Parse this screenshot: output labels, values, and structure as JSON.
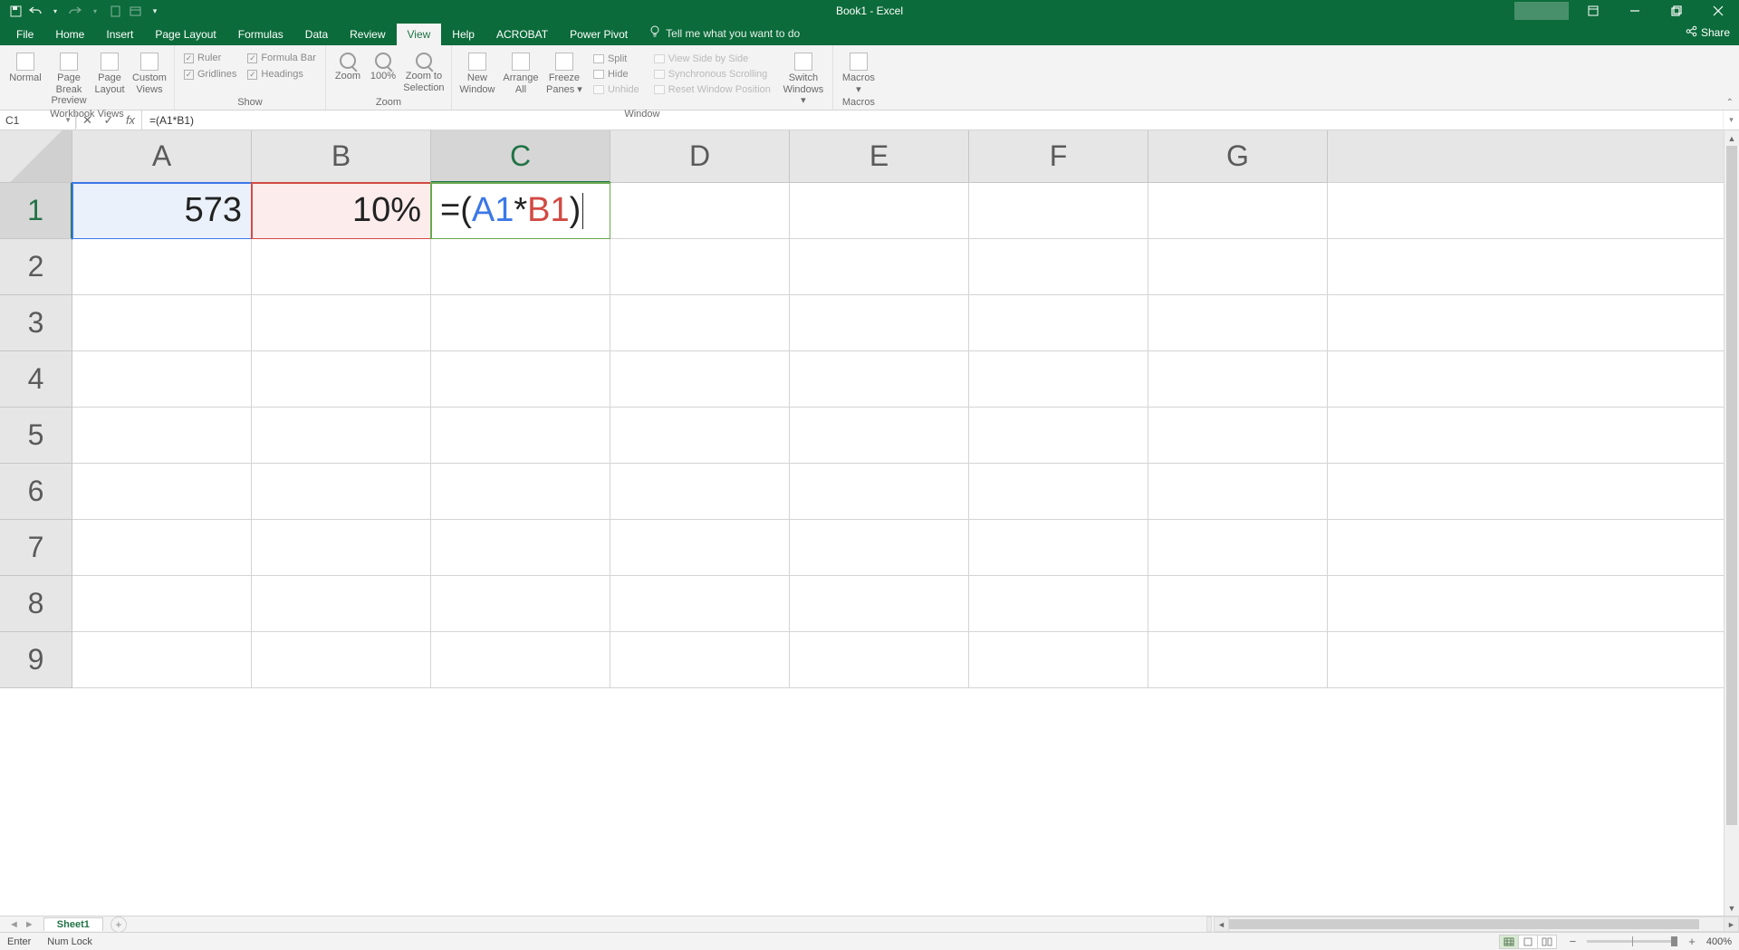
{
  "app": {
    "title": "Book1 - Excel"
  },
  "qat": {
    "items": [
      "save-icon",
      "undo-icon",
      "redo-icon",
      "new-icon",
      "grid-icon",
      "customize-icon"
    ]
  },
  "window": {
    "ribbon_display": "▾"
  },
  "tabs": {
    "file": "File",
    "list": [
      "Home",
      "Insert",
      "Page Layout",
      "Formulas",
      "Data",
      "Review",
      "View",
      "Help",
      "ACROBAT",
      "Power Pivot"
    ],
    "active_index": 6,
    "tell_me": "Tell me what you want to do",
    "share": "Share"
  },
  "ribbon": {
    "groups": {
      "workbook_views": {
        "label": "Workbook Views",
        "normal": "Normal",
        "page_break": "Page Break\nPreview",
        "page_layout": "Page\nLayout",
        "custom_views": "Custom\nViews"
      },
      "show": {
        "label": "Show",
        "ruler": "Ruler",
        "formula_bar": "Formula Bar",
        "gridlines": "Gridlines",
        "headings": "Headings"
      },
      "zoom": {
        "label": "Zoom",
        "zoom": "Zoom",
        "hundred": "100%",
        "to_selection": "Zoom to\nSelection"
      },
      "window": {
        "label": "Window",
        "new_window": "New\nWindow",
        "arrange_all": "Arrange\nAll",
        "freeze_panes": "Freeze\nPanes ▾",
        "split": "Split",
        "hide": "Hide",
        "unhide": "Unhide",
        "side_by_side": "View Side by Side",
        "sync_scroll": "Synchronous Scrolling",
        "reset_pos": "Reset Window Position",
        "switch": "Switch\nWindows ▾"
      },
      "macros": {
        "label": "Macros",
        "macros": "Macros\n▾"
      }
    }
  },
  "formula_bar": {
    "name_box": "C1",
    "cancel": "✕",
    "enter": "✓",
    "fx": "fx",
    "formula": "=(A1*B1)"
  },
  "grid": {
    "columns": [
      "A",
      "B",
      "C",
      "D",
      "E",
      "F",
      "G"
    ],
    "active_col_index": 2,
    "rows": [
      1,
      2,
      3,
      4,
      5,
      6,
      7,
      8,
      9
    ],
    "active_row_index": 0,
    "cells": {
      "A1": "573",
      "B1": "10%",
      "C1_prefix": "=(",
      "C1_ref1": "A1",
      "C1_op": "*",
      "C1_ref2": "B1",
      "C1_suffix": ")"
    }
  },
  "sheet_tabs": {
    "active": "Sheet1"
  },
  "statusbar": {
    "mode": "Enter",
    "numlock": "Num Lock",
    "zoom": "400%"
  }
}
